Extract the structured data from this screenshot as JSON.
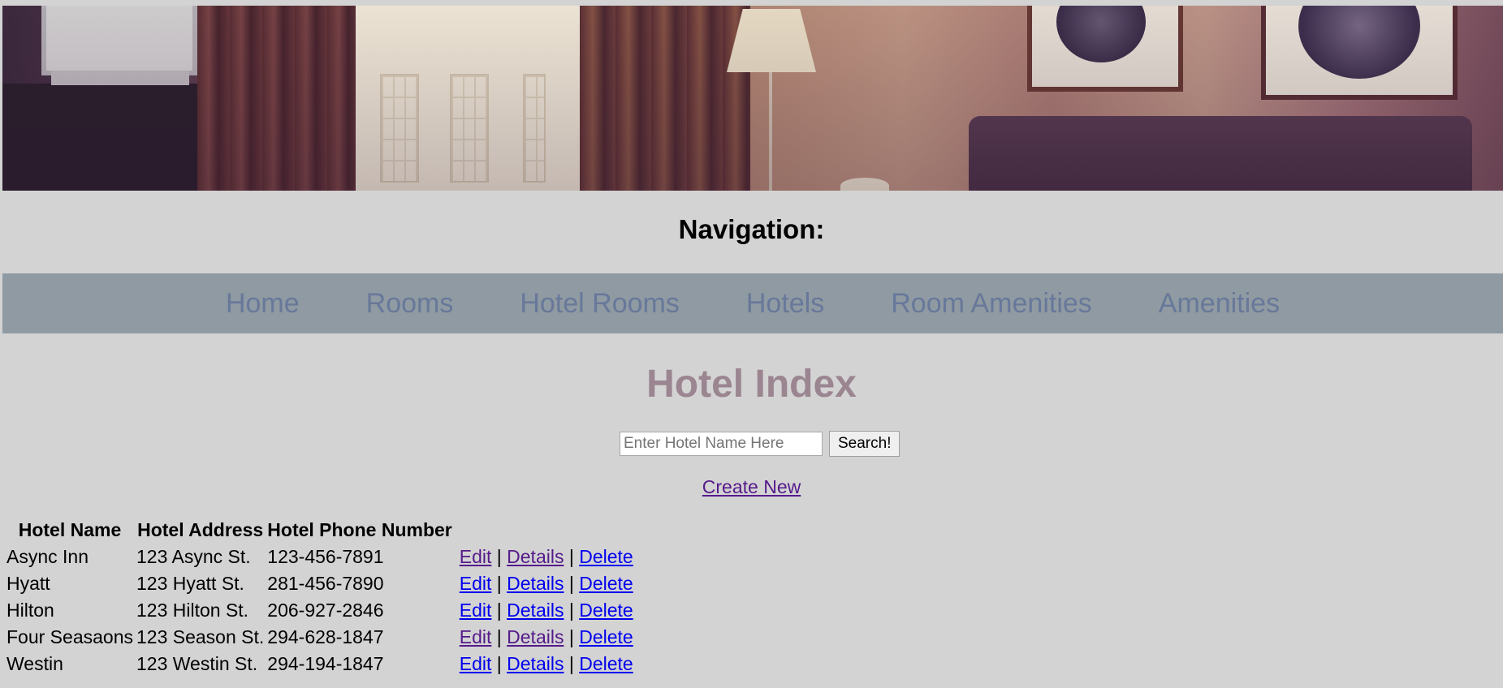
{
  "header": {
    "banner_alt": "hotel room banner"
  },
  "nav": {
    "heading": "Navigation:",
    "items": [
      {
        "label": "Home"
      },
      {
        "label": "Rooms"
      },
      {
        "label": "Hotel Rooms"
      },
      {
        "label": "Hotels"
      },
      {
        "label": "Room Amenities"
      },
      {
        "label": "Amenities"
      }
    ]
  },
  "main": {
    "title": "Hotel Index",
    "search": {
      "placeholder": "Enter Hotel Name Here",
      "value": "",
      "button_label": "Search!"
    },
    "create_new_label": "Create New",
    "table": {
      "columns": [
        "Hotel Name",
        "Hotel Address",
        "Hotel Phone Number",
        ""
      ],
      "rows": [
        {
          "name": "Async Inn",
          "address": "123 Async St.",
          "phone": "123-456-7891"
        },
        {
          "name": "Hyatt",
          "address": "123 Hyatt St.",
          "phone": "281-456-7890"
        },
        {
          "name": "Hilton",
          "address": "123 Hilton St.",
          "phone": "206-927-2846"
        },
        {
          "name": "Four Seasaons",
          "address": "123 Season St.",
          "phone": "294-628-1847"
        },
        {
          "name": "Westin",
          "address": "123 Westin St.",
          "phone": "294-194-1847"
        }
      ],
      "actions": {
        "edit": "Edit",
        "details": "Details",
        "delete": "Delete",
        "separator": "|"
      }
    }
  },
  "colors": {
    "page_bg": "#d3d3d3",
    "navbar_bg": "#8f9aa2",
    "nav_link": "#68789a",
    "title": "#9a8590",
    "link": "#0000ee",
    "visited_link": "#551a8b"
  }
}
